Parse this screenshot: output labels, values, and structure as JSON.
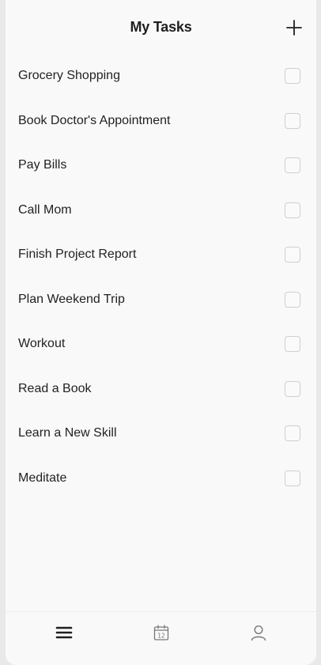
{
  "header": {
    "title": "My Tasks",
    "add_icon": "plus-icon"
  },
  "tasks": [
    {
      "label": "Grocery Shopping",
      "checked": false
    },
    {
      "label": "Book Doctor's Appointment",
      "checked": false
    },
    {
      "label": "Pay Bills",
      "checked": false
    },
    {
      "label": "Call Mom",
      "checked": false
    },
    {
      "label": "Finish Project Report",
      "checked": false
    },
    {
      "label": "Plan Weekend Trip",
      "checked": false
    },
    {
      "label": "Workout",
      "checked": false
    },
    {
      "label": "Read a Book",
      "checked": false
    },
    {
      "label": "Learn a New Skill",
      "checked": false
    },
    {
      "label": "Meditate",
      "checked": false
    }
  ],
  "tabbar": {
    "items": [
      {
        "icon": "list-icon",
        "active": true
      },
      {
        "icon": "calendar-icon",
        "day": "12",
        "active": false
      },
      {
        "icon": "user-icon",
        "active": false
      }
    ]
  },
  "colors": {
    "background": "#f9f9f9",
    "text": "#222222",
    "checkbox_border": "#cfcfcf",
    "icon_active": "#1f1f1f",
    "icon_inactive": "#777777"
  }
}
